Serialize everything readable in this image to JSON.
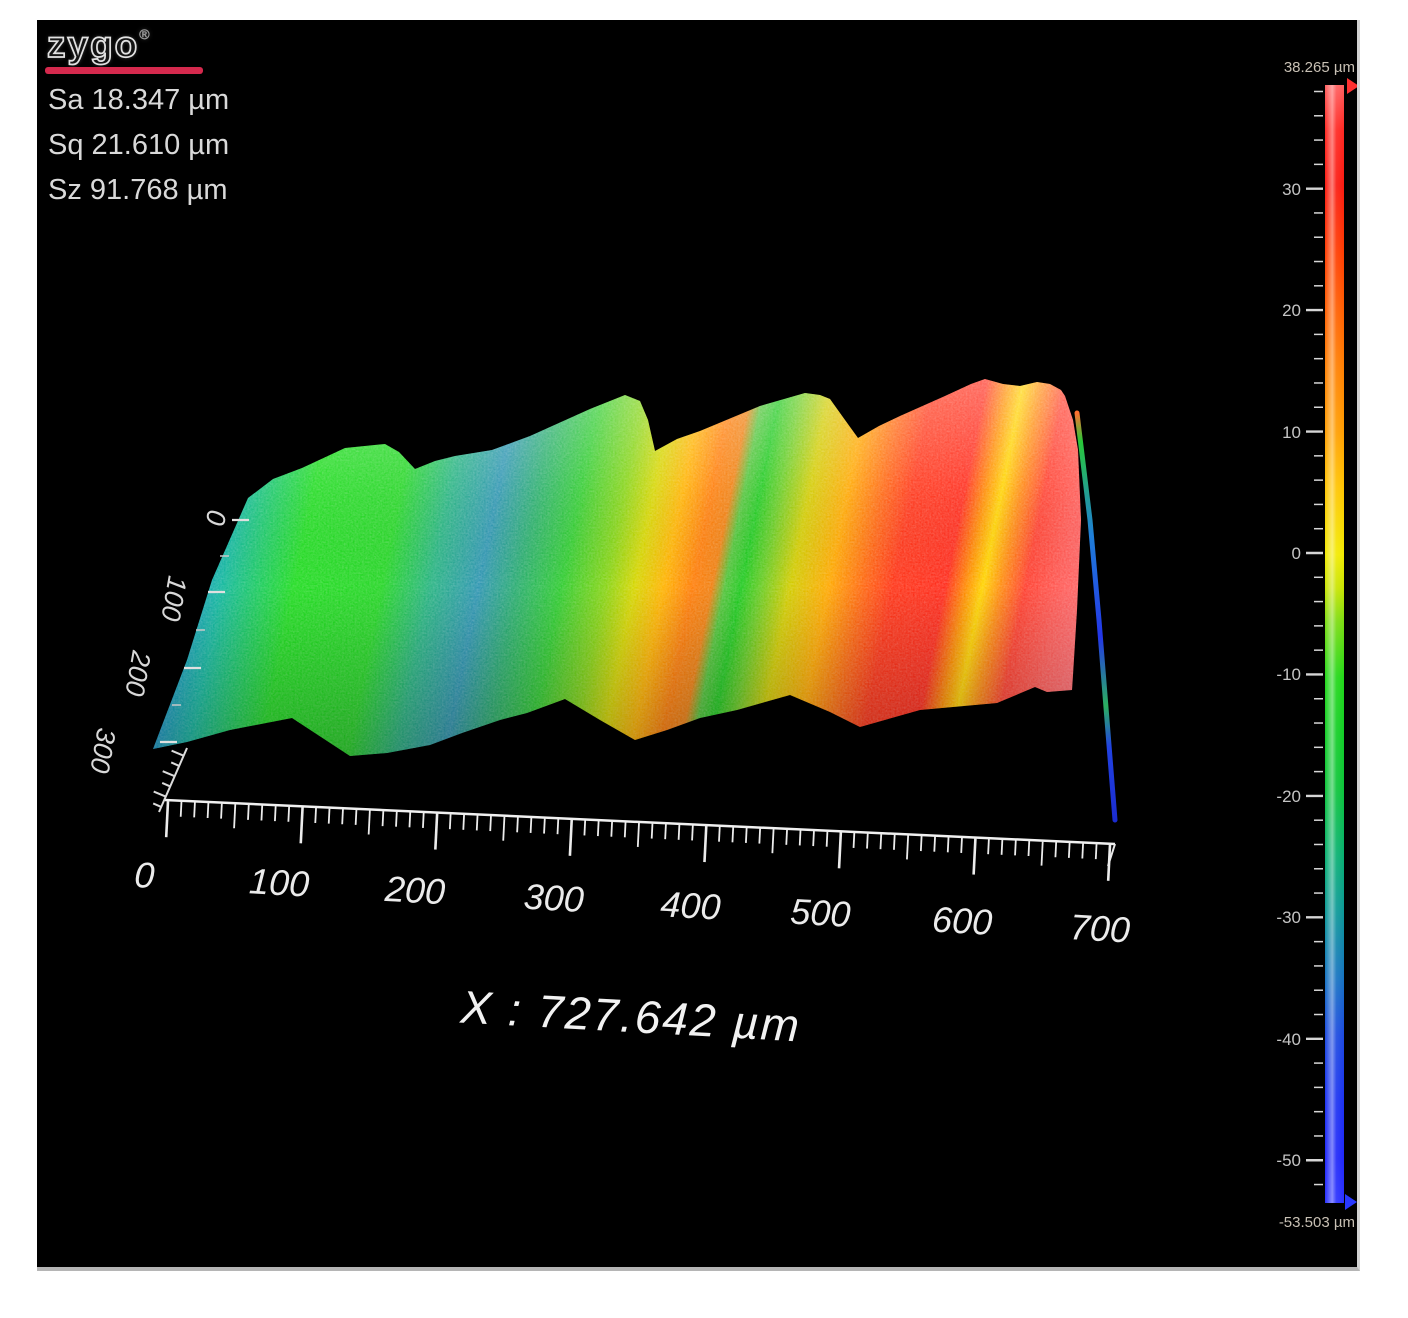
{
  "logo": {
    "text": "zygo",
    "registered": "®",
    "underline_color": "#d5294d"
  },
  "stats": {
    "lines": [
      "Sa 18.347 µm",
      "Sq 21.610 µm",
      "Sz 91.768 µm"
    ]
  },
  "x_axis": {
    "tick_labels": [
      "0",
      "100",
      "200",
      "300",
      "400",
      "500",
      "600",
      "700"
    ],
    "caption": "X : 727.642 µm"
  },
  "y_axis": {
    "tick_labels": [
      "0",
      "100",
      "200",
      "300"
    ]
  },
  "colorbar": {
    "max_label": "38.265 µm",
    "min_label": "-53.503 µm",
    "tick_labels": [
      "30",
      "20",
      "10",
      "0",
      "-10",
      "-20",
      "-30",
      "-40",
      "-50"
    ]
  },
  "gradients": {
    "surface": [
      [
        0.0,
        "#2a5fe0"
      ],
      [
        0.05,
        "#1e8fd0"
      ],
      [
        0.095,
        "#14b8a0"
      ],
      [
        0.135,
        "#1ccc5c"
      ],
      [
        0.17,
        "#22dc22"
      ],
      [
        0.26,
        "#26d626"
      ],
      [
        0.31,
        "#28b482"
      ],
      [
        0.36,
        "#2f96b2"
      ],
      [
        0.4,
        "#2aae6e"
      ],
      [
        0.445,
        "#30cc30"
      ],
      [
        0.49,
        "#86d414"
      ],
      [
        0.52,
        "#d6d600"
      ],
      [
        0.55,
        "#ffb300"
      ],
      [
        0.58,
        "#ff7d08"
      ],
      [
        0.6,
        "#f08010"
      ],
      [
        0.613,
        "#52c43a"
      ],
      [
        0.63,
        "#1fca1f"
      ],
      [
        0.65,
        "#66cc22"
      ],
      [
        0.68,
        "#d2cc00"
      ],
      [
        0.72,
        "#ffa800"
      ],
      [
        0.757,
        "#ff6410"
      ],
      [
        0.786,
        "#ff3518"
      ],
      [
        0.84,
        "#ff2c1c"
      ],
      [
        0.862,
        "#ff9100"
      ],
      [
        0.878,
        "#ffd400"
      ],
      [
        0.897,
        "#ff8c10"
      ],
      [
        0.922,
        "#ff4030"
      ],
      [
        0.957,
        "#ff5a55"
      ],
      [
        0.995,
        "#ff6e74"
      ]
    ],
    "colorbar": [
      [
        0.0,
        "#ff6060"
      ],
      [
        0.04,
        "#ff2822"
      ],
      [
        0.09,
        "#fb1a10"
      ],
      [
        0.15,
        "#ff3c00"
      ],
      [
        0.2,
        "#ff5e00"
      ],
      [
        0.25,
        "#ff7e00"
      ],
      [
        0.31,
        "#ff9e00"
      ],
      [
        0.36,
        "#ffc400"
      ],
      [
        0.42,
        "#f2ea00"
      ],
      [
        0.45,
        "#c8e400"
      ],
      [
        0.48,
        "#7cdc10"
      ],
      [
        0.53,
        "#22d818"
      ],
      [
        0.58,
        "#12ce26"
      ],
      [
        0.63,
        "#0cc43a"
      ],
      [
        0.69,
        "#08b072"
      ],
      [
        0.74,
        "#0c9898"
      ],
      [
        0.8,
        "#1672c2"
      ],
      [
        0.85,
        "#1c4ae0"
      ],
      [
        0.91,
        "#1c32f2"
      ],
      [
        0.96,
        "#2028fa"
      ],
      [
        1.0,
        "#2b32ff"
      ]
    ],
    "edge": [
      [
        0.0,
        "#ff7030"
      ],
      [
        0.07,
        "#28c838"
      ],
      [
        0.3,
        "#1f7fd8"
      ],
      [
        0.55,
        "#2336e8"
      ],
      [
        0.72,
        "#2bb060"
      ],
      [
        0.82,
        "#2142e2"
      ],
      [
        1.0,
        "#1b2cd0"
      ]
    ]
  },
  "chart_data": {
    "type": "3d-surface-map",
    "instrument_logo": "zygo",
    "stats_um": {
      "Sa": 18.347,
      "Sq": 21.61,
      "Sz": 91.768
    },
    "x_axis": {
      "unit": "µm",
      "ticks": [
        0,
        100,
        200,
        300,
        400,
        500,
        600,
        700
      ],
      "length_um": 727.642,
      "length_label": "X : 727.642 µm"
    },
    "y_axis": {
      "unit": "µm",
      "ticks": [
        0,
        100,
        200,
        300
      ]
    },
    "z_scale": {
      "unit": "µm",
      "max": 38.265,
      "min": -53.503,
      "ticks": [
        30,
        20,
        10,
        0,
        -10,
        -20,
        -30,
        -40,
        -50
      ]
    },
    "surface_description": {
      "form": "tilted corrugated surface with diagonal groove ridges",
      "height_trend": "rises from ≈ -35 µm (blue) at x≈0 to ≈ +38 µm (red/pink) at x≈727 µm",
      "approx_groove_valleys_x_um": [
        240,
        430,
        590
      ],
      "approx_ridge_peaks_x_um": [
        150,
        345,
        480,
        610
      ],
      "right_edge": "sharp drop to minimum height at x ≈ 727 µm"
    },
    "legend_position": "right colorbar",
    "background": "#000000"
  }
}
